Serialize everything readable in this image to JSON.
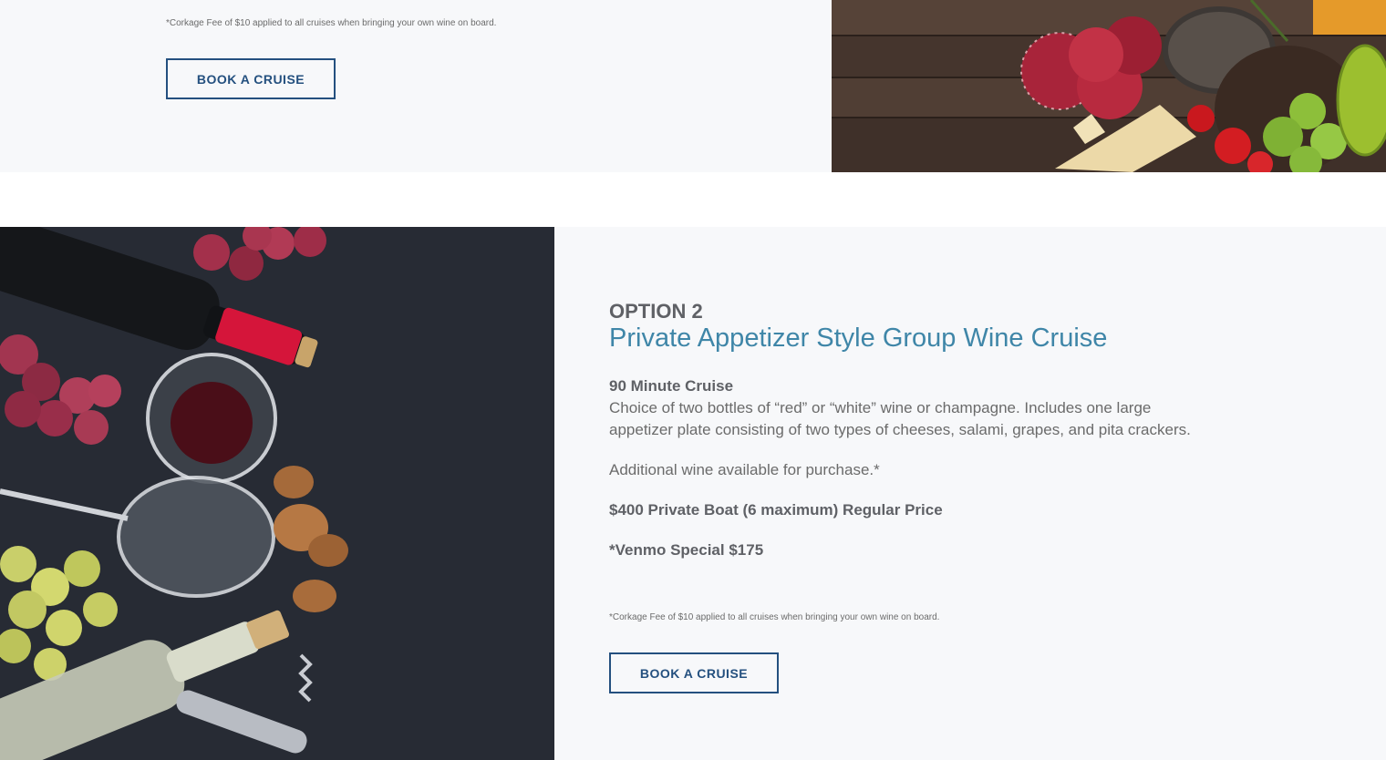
{
  "option1": {
    "corkage_note": "*Corkage Fee of $10 applied to all cruises when bringing your own wine on board.",
    "book_button": "BOOK A CRUISE"
  },
  "option2": {
    "label": "OPTION 2",
    "title": "Private Appetizer Style Group Wine Cruise",
    "duration": "90 Minute Cruise",
    "description": "Choice of two bottles of “red” or “white” wine or champagne. Includes one large appetizer plate consisting of two types of cheeses, salami, grapes, and pita crackers.",
    "additional": "Additional wine available for purchase.*",
    "price": "$400 Private Boat (6 maximum) Regular Price",
    "special": "*Venmo Special $175",
    "corkage_note": "*Corkage Fee of $10 applied to all cruises when bringing your own wine on board.",
    "book_button": "BOOK A CRUISE"
  },
  "colors": {
    "section_bg": "#f7f8fa",
    "button_border": "#24507f",
    "title_accent": "#3f86a8",
    "text": "#6b6b6b"
  }
}
